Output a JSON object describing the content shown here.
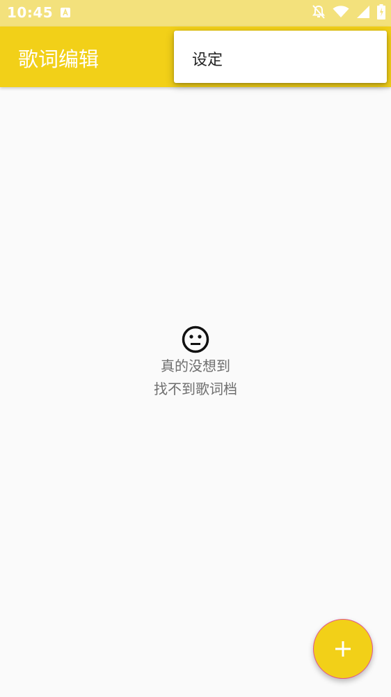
{
  "status_bar": {
    "time": "10:45",
    "icons": [
      "notification-a-icon",
      "do-not-disturb-icon",
      "wifi-icon",
      "signal-icon",
      "battery-icon"
    ]
  },
  "app_bar": {
    "title": "歌词编辑"
  },
  "overflow_menu": {
    "items": [
      {
        "label": "设定"
      }
    ]
  },
  "empty_state": {
    "icon": "neutral-face-icon",
    "line1": "真的没想到",
    "line2": "找不到歌词档"
  },
  "fab": {
    "icon": "plus-icon"
  },
  "colors": {
    "primary": "#f2d018",
    "status_bar": "#f3e17c",
    "background": "#fafafa",
    "fab_border": "#e05590",
    "empty_text": "#6e6e6e"
  }
}
